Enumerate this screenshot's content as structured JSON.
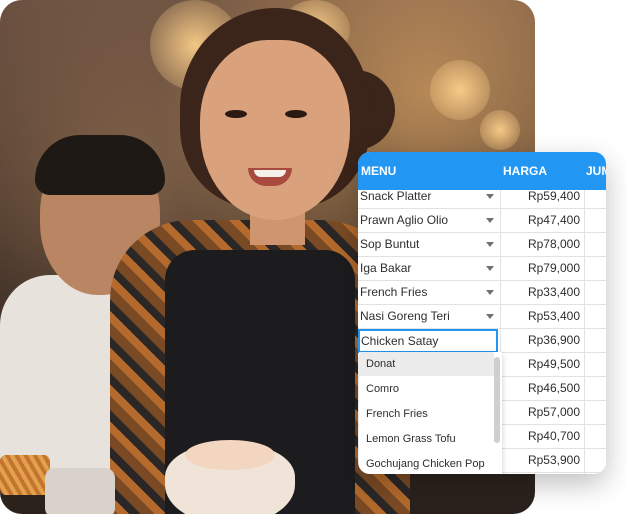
{
  "table": {
    "headers": {
      "menu": "MENU",
      "harga": "HARGA",
      "jumlah": "JUM"
    },
    "rows": [
      {
        "name": "Snack Platter",
        "price": "Rp59,400"
      },
      {
        "name": "Prawn Aglio Olio",
        "price": "Rp47,400"
      },
      {
        "name": "Sop Buntut",
        "price": "Rp78,000"
      },
      {
        "name": "Iga Bakar",
        "price": "Rp79,000"
      },
      {
        "name": "French Fries",
        "price": "Rp33,400"
      },
      {
        "name": "Nasi Goreng Teri",
        "price": "Rp53,400"
      },
      {
        "name": "",
        "price": "Rp36,900"
      },
      {
        "name": "",
        "price": "Rp49,500"
      },
      {
        "name": "",
        "price": "Rp46,500"
      },
      {
        "name": "",
        "price": "Rp57,000"
      },
      {
        "name": "",
        "price": "Rp40,700"
      },
      {
        "name": "",
        "price": "Rp53,900"
      }
    ],
    "editing_value": "Chicken Satay"
  },
  "dropdown": {
    "options": [
      {
        "label": "Donat",
        "selected": true
      },
      {
        "label": "Comro",
        "selected": false
      },
      {
        "label": "French Fries",
        "selected": false
      },
      {
        "label": "Lemon Grass Tofu",
        "selected": false
      },
      {
        "label": "Gochujang Chicken Pop",
        "selected": false
      }
    ]
  },
  "colors": {
    "header": "#2196f3",
    "edit_border": "#2196f3"
  }
}
